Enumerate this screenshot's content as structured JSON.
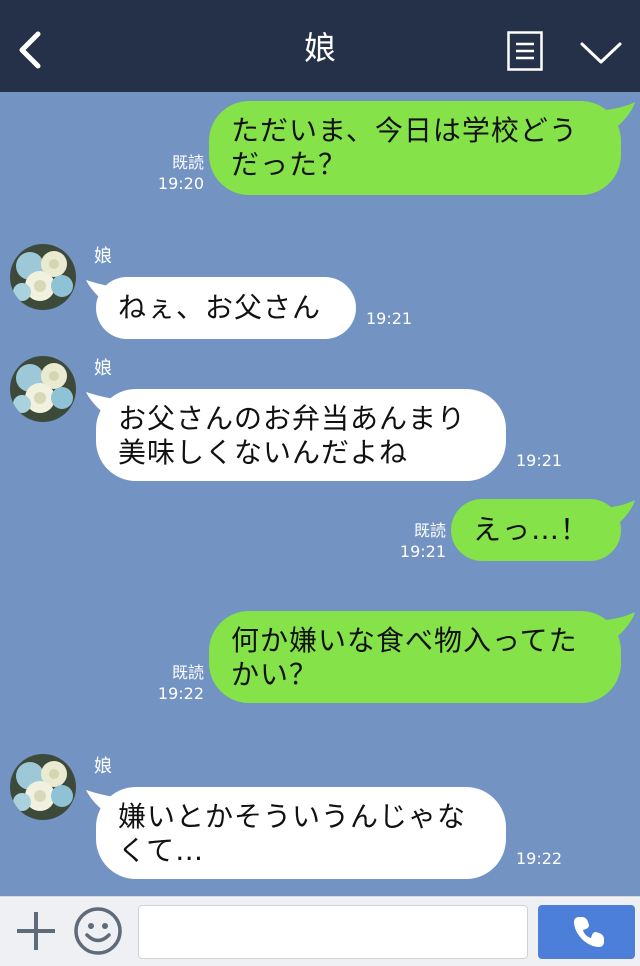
{
  "header": {
    "title": "娘",
    "back_icon": "chevron-left-icon",
    "menu_icon": "list-icon",
    "collapse_icon": "chevron-down-icon",
    "bg_color": "#253149"
  },
  "chat": {
    "bg_color": "#7393c2",
    "messages": [
      {
        "dir": "out",
        "lines": [
          "ただいま、今日は学校どう",
          "だった？"
        ],
        "read": "既読",
        "time": "19:20"
      },
      {
        "dir": "in",
        "sender": "娘",
        "lines": [
          "ねぇ、お父さん"
        ],
        "time": "19:21"
      },
      {
        "dir": "in",
        "sender": "娘",
        "lines": [
          "お父さんのお弁当あんまり",
          "美味しくないんだよね"
        ],
        "time": "19:21"
      },
      {
        "dir": "out",
        "lines": [
          "えっ…！"
        ],
        "read": "既読",
        "time": "19:21"
      },
      {
        "dir": "out",
        "lines": [
          "何か嫌いな食べ物入ってた",
          "かい？"
        ],
        "read": "既読",
        "time": "19:22"
      },
      {
        "dir": "in",
        "sender": "娘",
        "lines": [
          "嫌いとかそういうんじゃな",
          "くて…"
        ],
        "time": "19:22"
      }
    ]
  },
  "footer": {
    "plus_icon": "plus-icon",
    "sticker_icon": "smiley-icon",
    "input_placeholder": "",
    "call_icon": "phone-icon",
    "call_color": "#4c7fd9"
  },
  "colors": {
    "outgoing_bubble": "#85e249",
    "incoming_bubble": "#ffffff"
  }
}
